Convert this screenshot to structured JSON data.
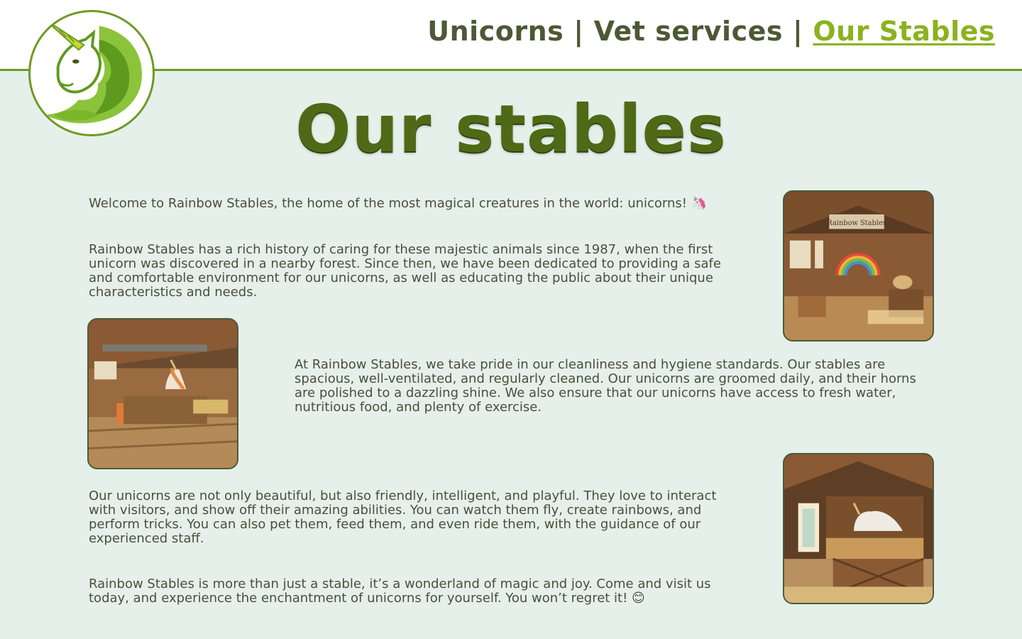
{
  "nav": {
    "items": [
      {
        "label": "Unicorns",
        "active": false
      },
      {
        "label": "Vet services",
        "active": false
      },
      {
        "label": "Our Stables",
        "active": true
      }
    ],
    "separator": "|"
  },
  "logo": {
    "icon": "unicorn-head-icon"
  },
  "page": {
    "title": "Our stables"
  },
  "content": {
    "paragraphs": [
      "Welcome to Rainbow Stables, the home of the most magical creatures in the world: unicorns! 🦄",
      "Rainbow Stables has a rich history of caring for these majestic animals since 1987, when the first unicorn was discovered in a nearby forest. Since then, we have been dedicated to providing a safe and comfortable environment for our unicorns, as well as educating the public about their unique characteristics and needs.",
      "At Rainbow Stables, we take pride in our cleanliness and hygiene standards. Our stables are spacious, well-ventilated, and regularly cleaned. Our unicorns are groomed daily, and their horns are polished to a dazzling shine. We also ensure that our unicorns have access to fresh water, nutritious food, and plenty of exercise.",
      "Our unicorns are not only beautiful, but also friendly, intelligent, and playful. They love to interact with visitors, and show off their amazing abilities. You can watch them fly, create rainbows, and perform tricks. You can also pet them, feed them, and even ride them, with the guidance of our experienced staff.",
      "Rainbow Stables is more than just a stable, it’s a wonderland of magic and joy. Come and visit us today, and experience the enchantment of unicorns for yourself. You won’t regret it! 😊"
    ]
  },
  "images": {
    "stable1_sign": "Rainbow Stables"
  },
  "colors": {
    "background": "#e6f0ea",
    "accent": "#6f9a24",
    "active_link": "#8bb21f",
    "title": "#4e6a16",
    "text": "#4a4f3c"
  }
}
